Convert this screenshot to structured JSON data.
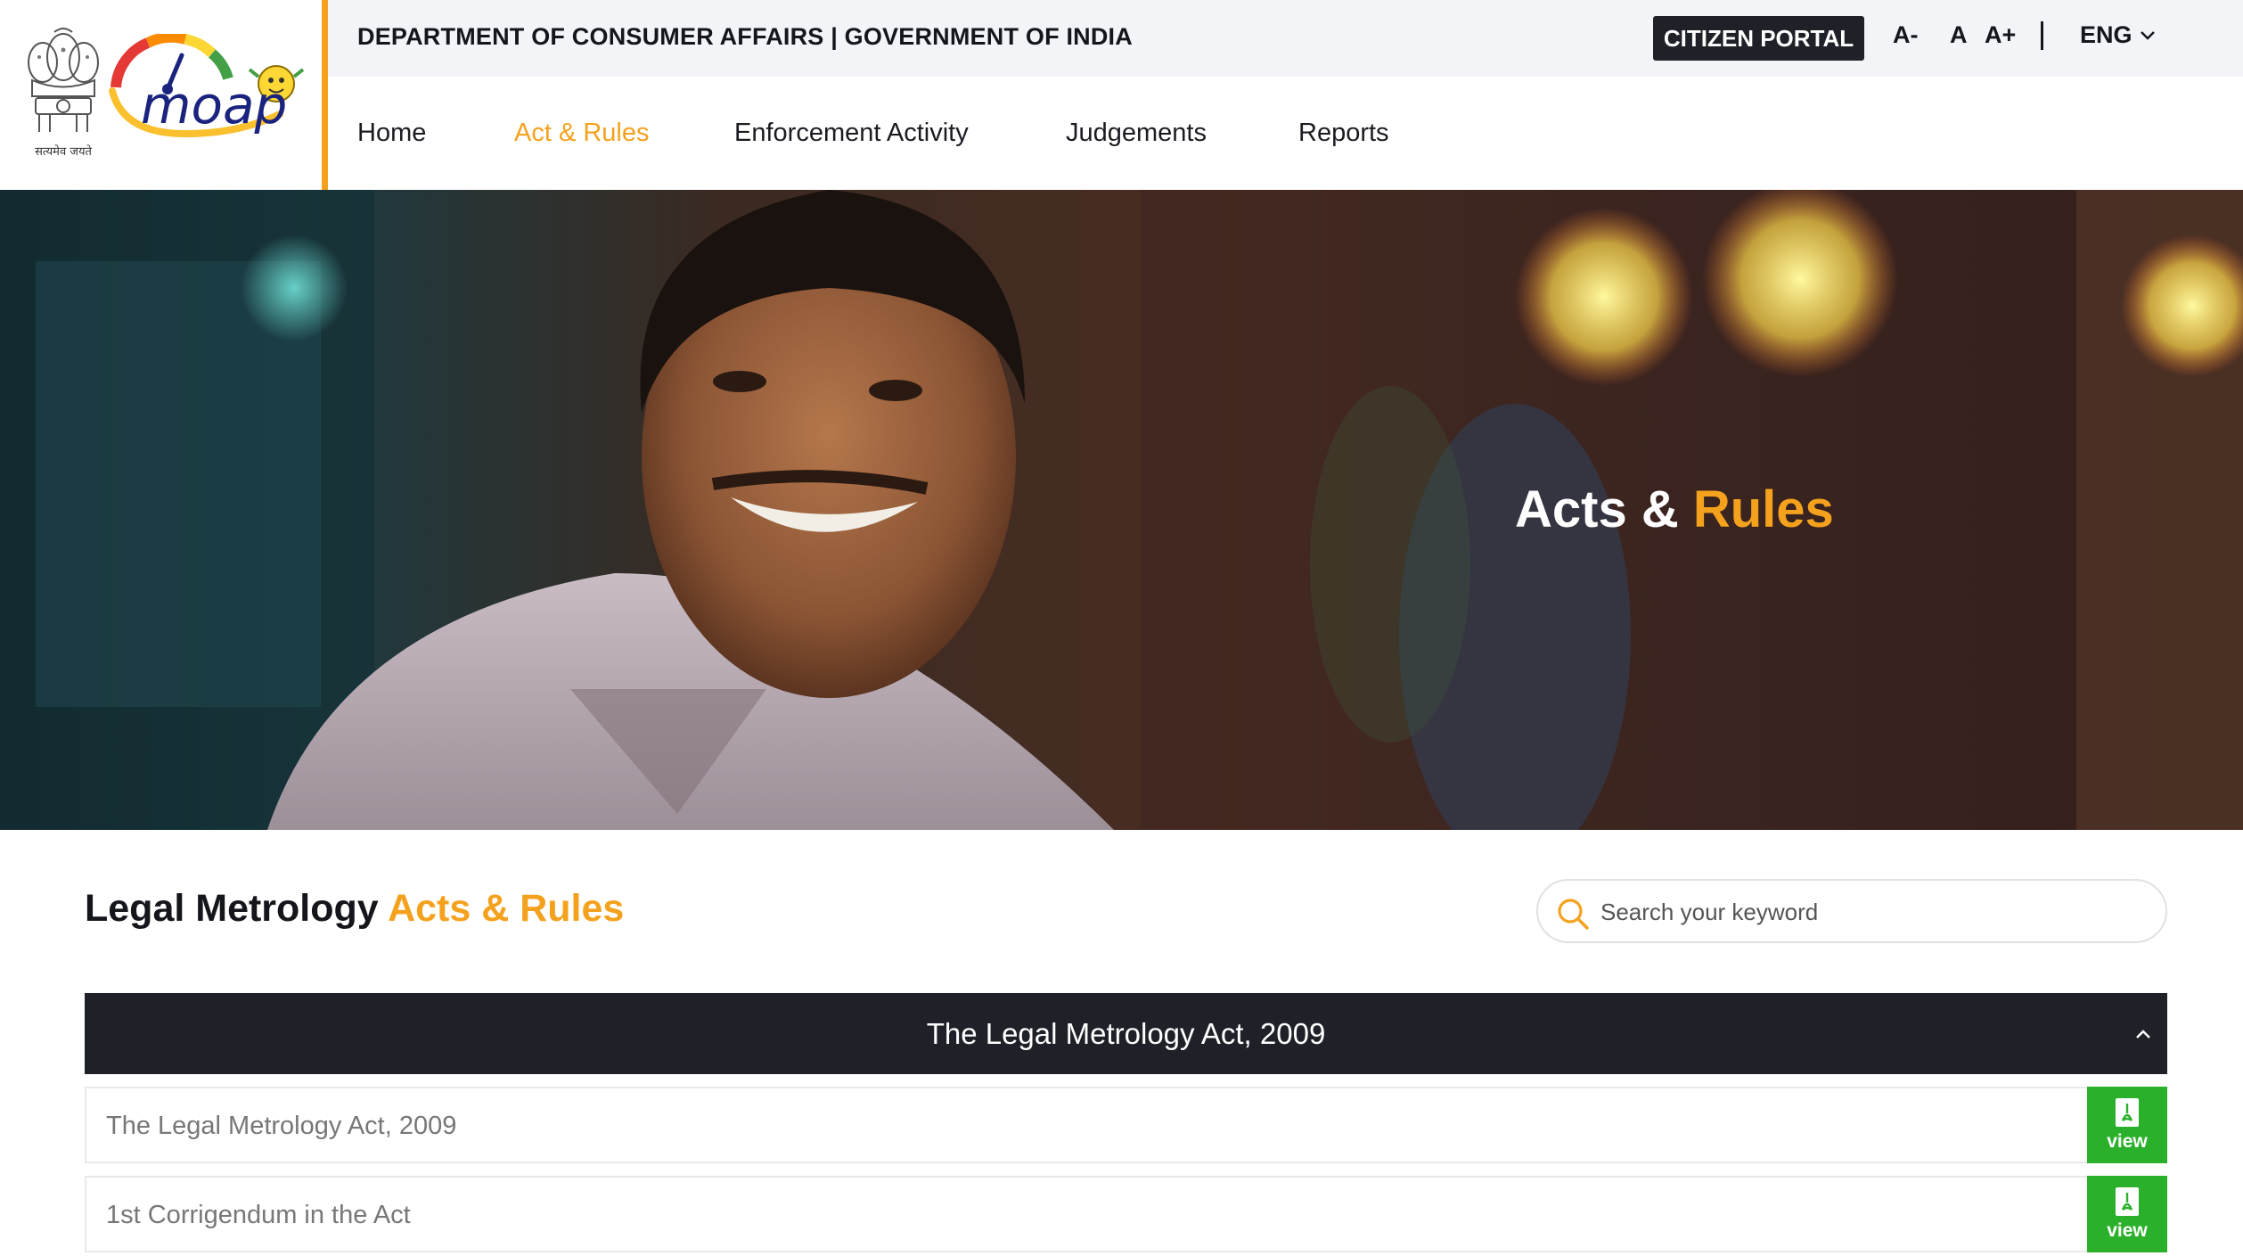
{
  "header": {
    "emblem_caption": "सत्यमेव जयते",
    "logo_text": "moap",
    "department": "DEPARTMENT OF CONSUMER AFFAIRS | GOVERNMENT OF INDIA",
    "citizen_portal": "CITIZEN PORTAL",
    "font_decrease": "A-",
    "font_normal": "A",
    "font_increase": "A+",
    "language": "ENG"
  },
  "nav": {
    "items": [
      {
        "label": "Home"
      },
      {
        "label": "Act & Rules"
      },
      {
        "label": "Enforcement Activity"
      },
      {
        "label": "Judgements"
      },
      {
        "label": "Reports"
      }
    ],
    "active": "Act & Rules"
  },
  "hero": {
    "title_part1": "Acts &",
    "title_part2": "Rules"
  },
  "section": {
    "title_part1": "Legal Metrology",
    "title_part2": "Acts & Rules"
  },
  "search": {
    "placeholder": "Search your keyword"
  },
  "accordion": {
    "title": "The Legal Metrology Act, 2009",
    "items": [
      {
        "label": "The Legal Metrology Act, 2009",
        "action": "view"
      },
      {
        "label": "1st Corrigendum in the Act",
        "action": "view"
      }
    ]
  },
  "colors": {
    "accent": "#f4a21e",
    "dark": "#1f2128",
    "view_green": "#2bb02b"
  }
}
